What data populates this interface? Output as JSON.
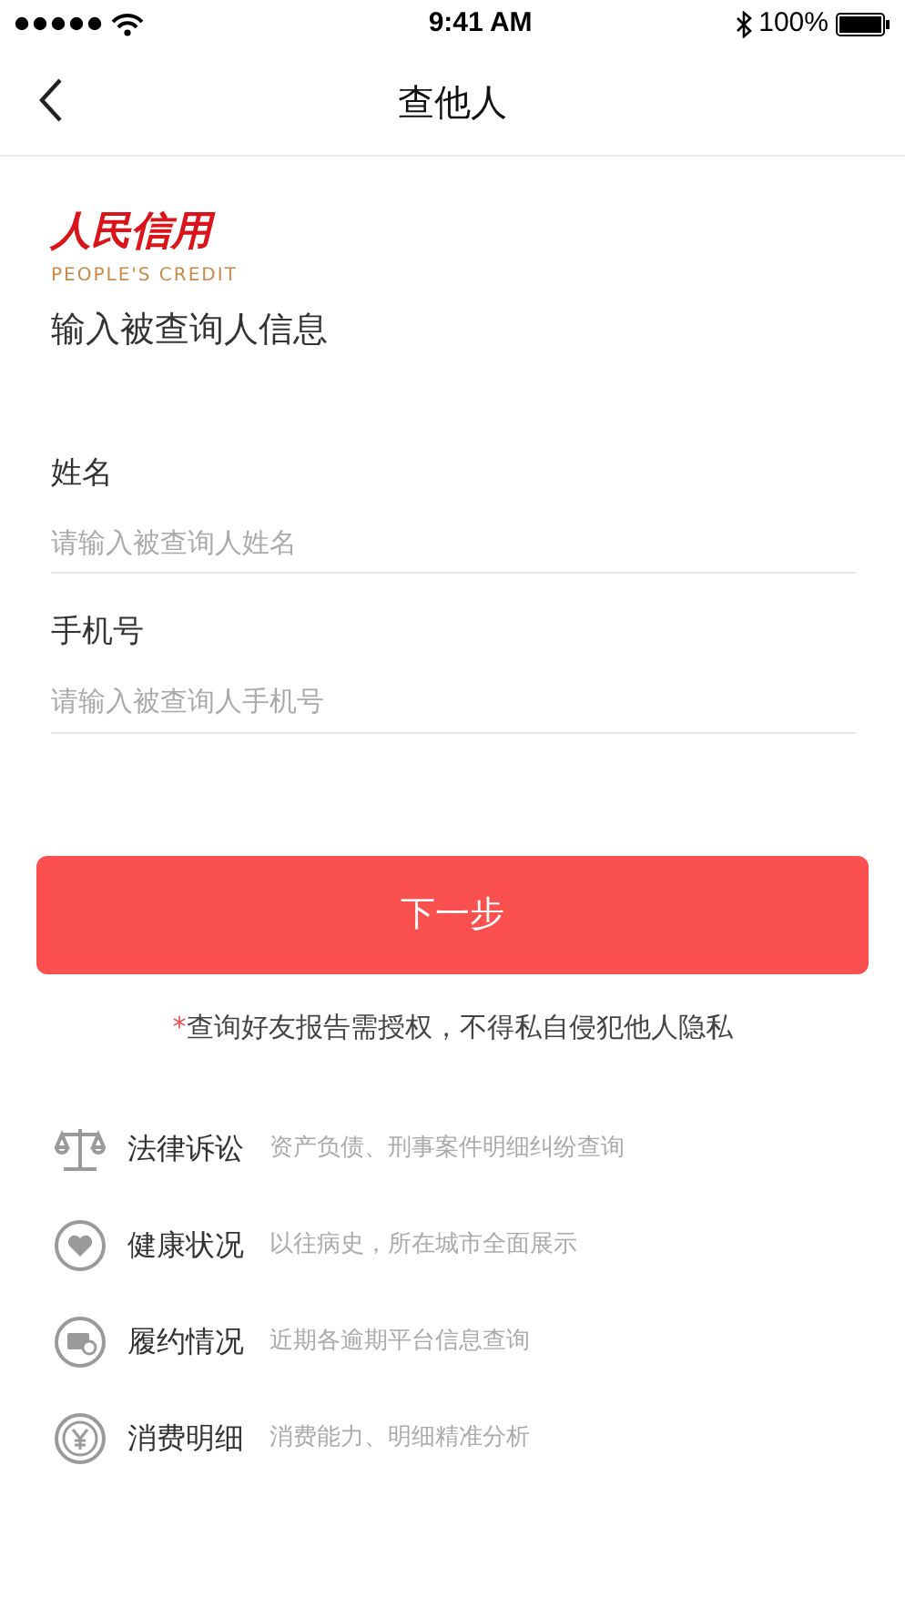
{
  "status_bar": {
    "time": "9:41 AM",
    "battery": "100%"
  },
  "nav": {
    "title": "查他人"
  },
  "logo": {
    "name": "人民信用",
    "subtitle": "PEOPLE'S CREDIT"
  },
  "heading": "输入被查询人信息",
  "fields": [
    {
      "label": "姓名",
      "placeholder": "请输入被查询人姓名"
    },
    {
      "label": "手机号",
      "placeholder": "请输入被查询人手机号"
    }
  ],
  "next_button": "下一步",
  "notice": {
    "mark": "*",
    "text": "查询好友报告需授权，不得私自侵犯他人隐私"
  },
  "features": [
    {
      "kind": "scale",
      "title": "法律诉讼",
      "desc": "资产负债、刑事案件明细纠纷查询"
    },
    {
      "kind": "heart",
      "title": "健康状况",
      "desc": "以往病史，所在城市全面展示"
    },
    {
      "kind": "card",
      "title": "履约情况",
      "desc": "近期各逾期平台信息查询"
    },
    {
      "kind": "yen",
      "title": "消费明细",
      "desc": "消费能力、明细精准分析"
    }
  ]
}
